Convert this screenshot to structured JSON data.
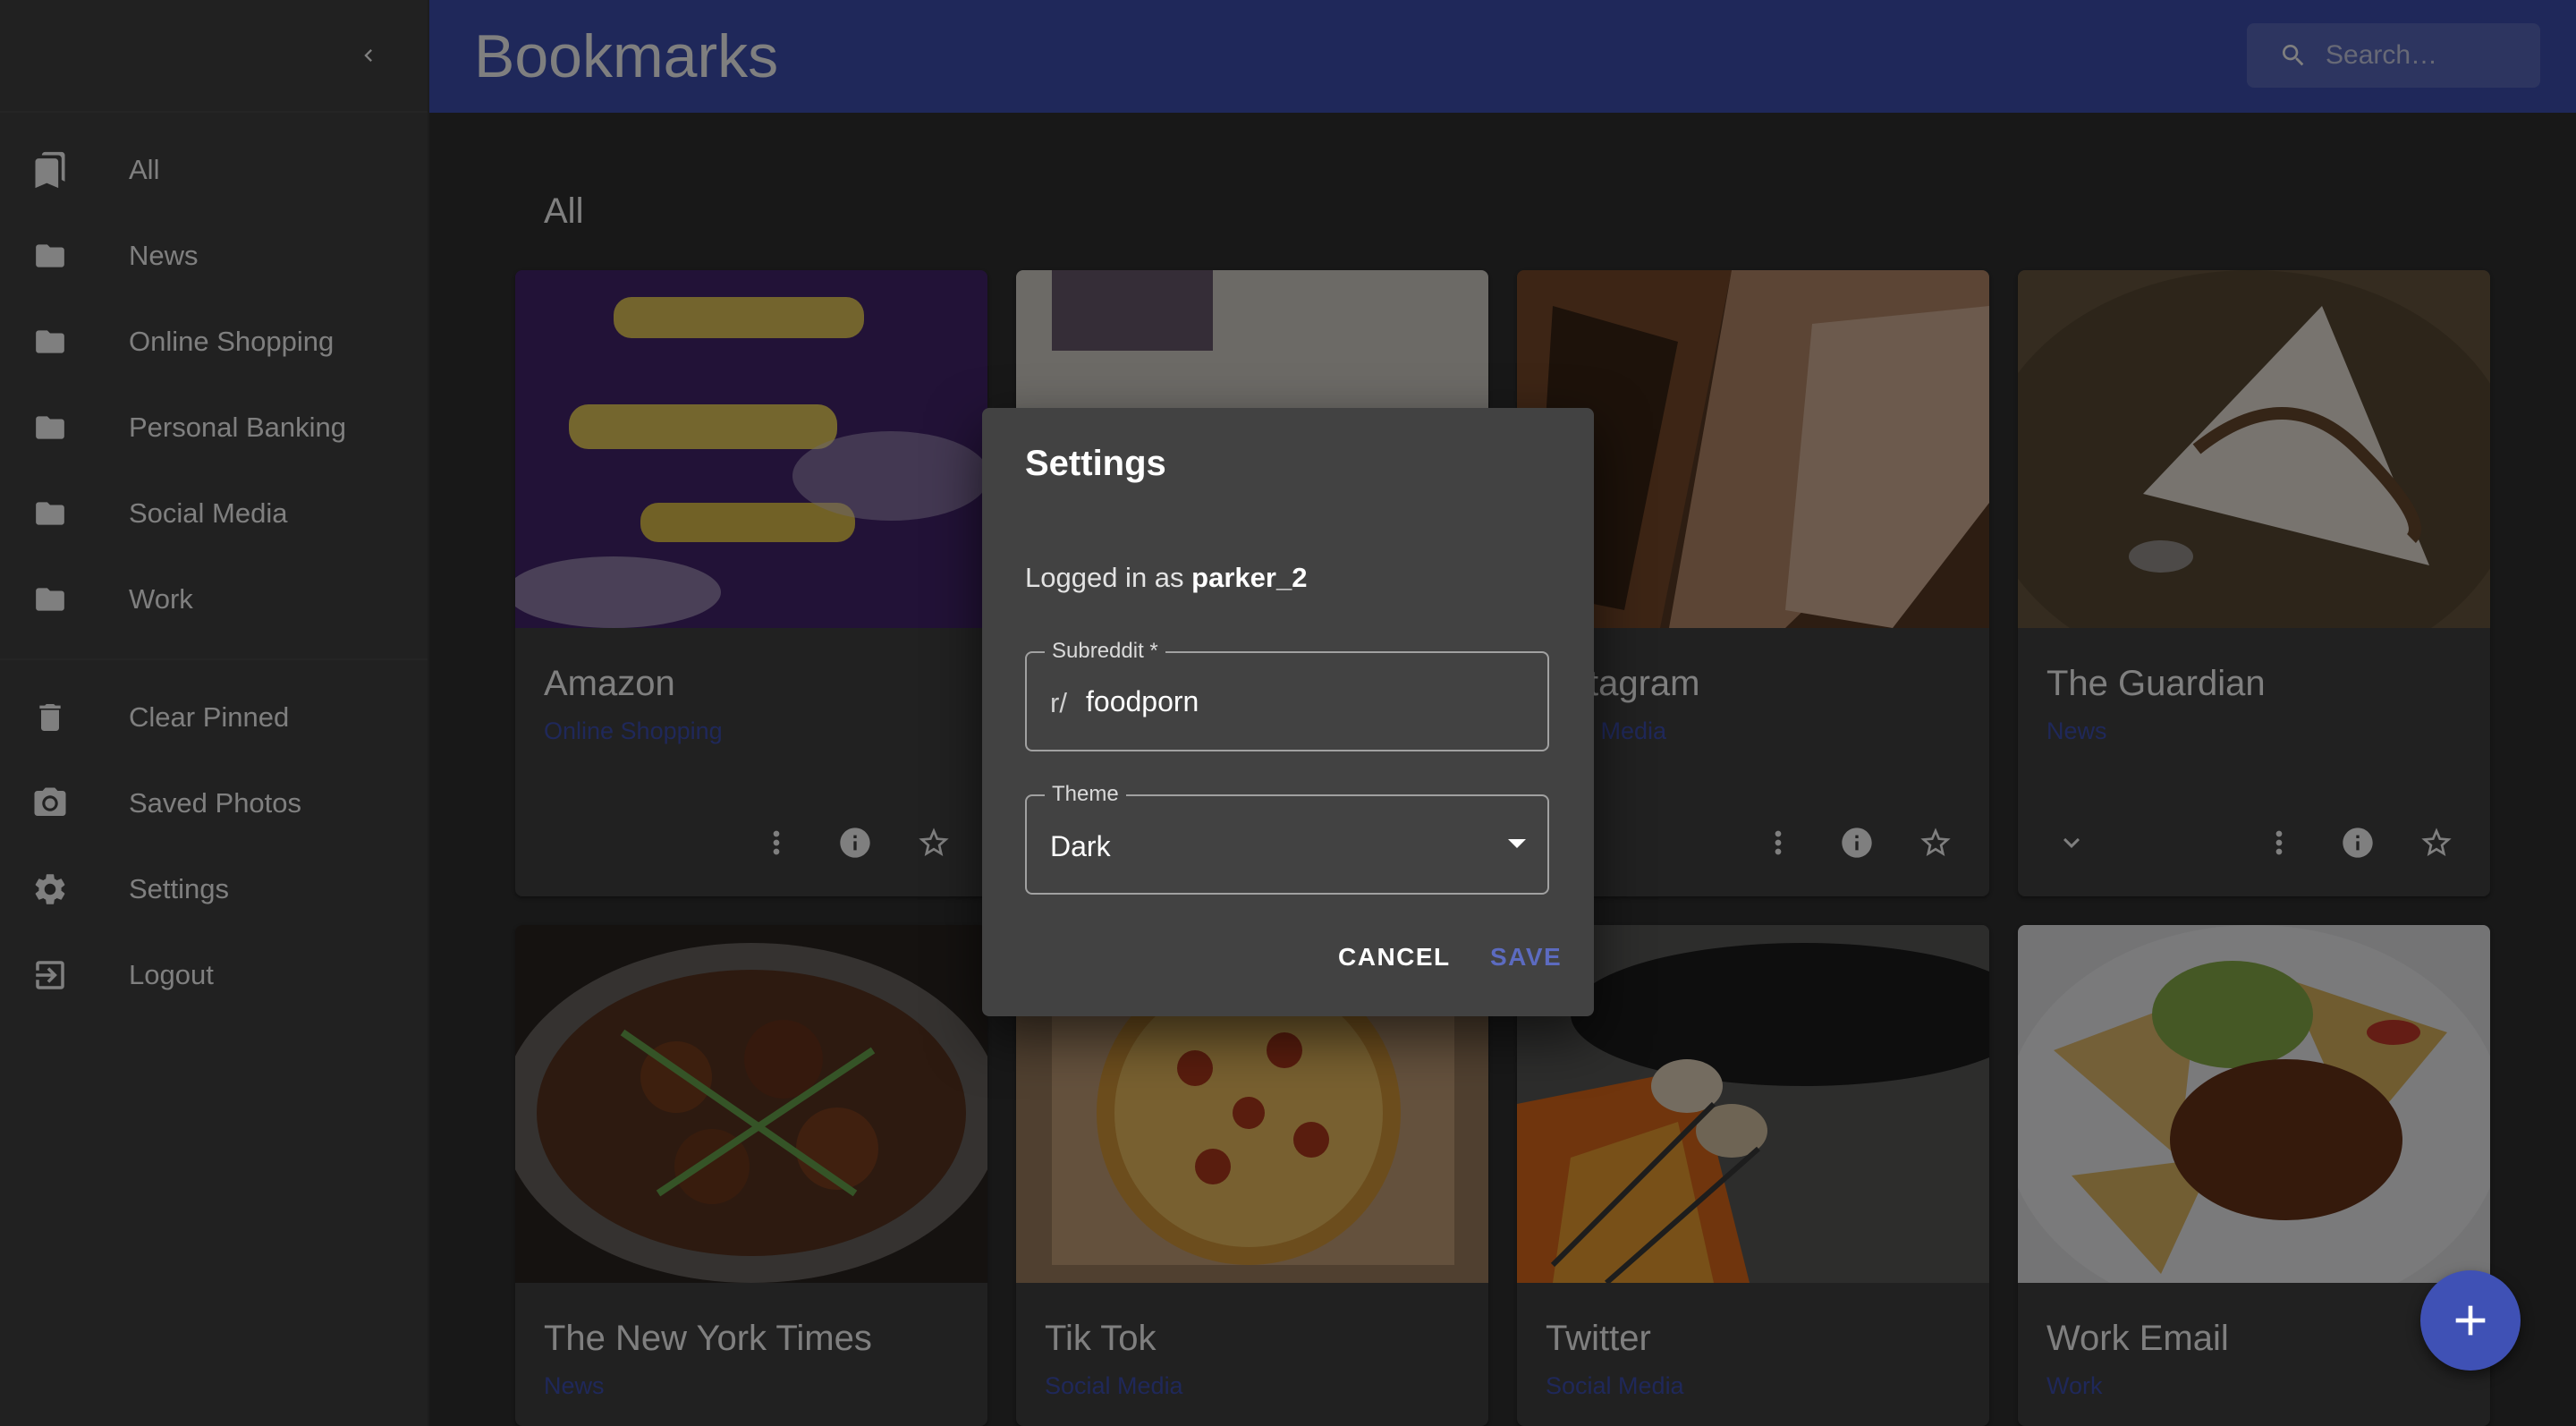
{
  "drawer": {
    "collapse_icon": "chevron-left-icon",
    "items": [
      {
        "label": "All",
        "icon": "bookmarks-icon"
      },
      {
        "label": "News",
        "icon": "folder-icon"
      },
      {
        "label": "Online Shopping",
        "icon": "folder-icon"
      },
      {
        "label": "Personal Banking",
        "icon": "folder-icon"
      },
      {
        "label": "Social Media",
        "icon": "folder-icon"
      },
      {
        "label": "Work",
        "icon": "folder-icon"
      }
    ],
    "actions": [
      {
        "label": "Clear Pinned",
        "icon": "trash-icon"
      },
      {
        "label": "Saved Photos",
        "icon": "camera-icon"
      },
      {
        "label": "Settings",
        "icon": "gear-icon"
      },
      {
        "label": "Logout",
        "icon": "logout-icon"
      }
    ]
  },
  "appbar": {
    "title": "Bookmarks",
    "search_placeholder": "Search…"
  },
  "main": {
    "section_title": "All",
    "cards": [
      {
        "title": "Amazon",
        "category": "Online Shopping"
      },
      {
        "title": "",
        "category": ""
      },
      {
        "title": "tagram",
        "category": "l Media"
      },
      {
        "title": "The Guardian",
        "category": "News"
      },
      {
        "title": "The New York Times",
        "category": "News"
      },
      {
        "title": "Tik Tok",
        "category": "Social Media"
      },
      {
        "title": "Twitter",
        "category": "Social Media"
      },
      {
        "title": "Work Email",
        "category": "Work"
      }
    ]
  },
  "dialog": {
    "title": "Settings",
    "logged_in_prefix": "Logged in as",
    "username": "parker_2",
    "subreddit_label": "Subreddit *",
    "subreddit_prefix": "r/",
    "subreddit_value": "foodporn",
    "theme_label": "Theme",
    "theme_value": "Dark",
    "cancel_label": "CANCEL",
    "save_label": "SAVE"
  },
  "fab": {
    "icon": "plus-icon"
  },
  "colors": {
    "primary": "#3f51b5",
    "surface": "#424242",
    "background": "#303030"
  }
}
